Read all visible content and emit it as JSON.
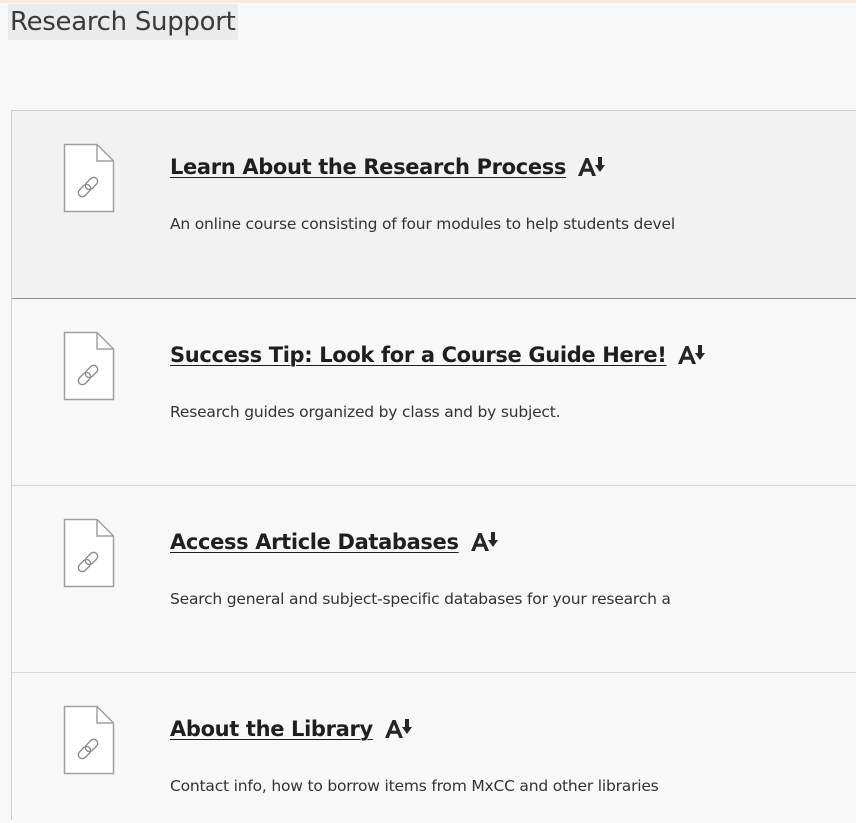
{
  "page": {
    "title": "Research Support"
  },
  "items": [
    {
      "title": "Learn About the Research Process",
      "description": "An online course consisting of four modules to help students devel",
      "icon": "link-document-icon"
    },
    {
      "title": "Success Tip: Look for a Course Guide Here!",
      "description": "Research guides organized by class and by subject.",
      "icon": "link-document-icon"
    },
    {
      "title": "Access Article Databases",
      "description": "Search general and subject-specific databases for your research a",
      "icon": "link-document-icon"
    },
    {
      "title": "About the Library",
      "description": "Contact info, how to borrow items from MxCC and other libraries",
      "icon": "link-document-icon"
    }
  ],
  "colors": {
    "background": "#f8f8f8",
    "highlighted_item": "#f2f2f2",
    "title_text": "#1f1f1f",
    "description_text": "#333333"
  }
}
